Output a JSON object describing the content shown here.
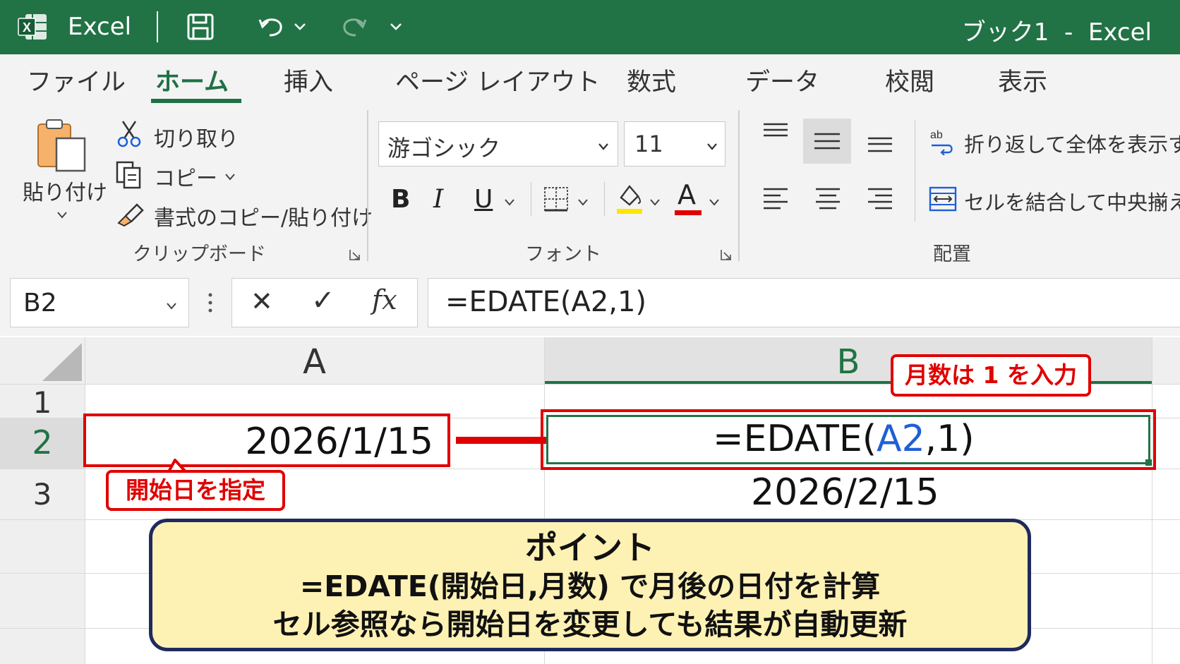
{
  "titlebar": {
    "app_name": "Excel",
    "window_title": "ブック1  -  Excel",
    "bg_color": "#217346"
  },
  "tabs": [
    {
      "label": "ファイル",
      "active": false
    },
    {
      "label": "ホーム",
      "active": true
    },
    {
      "label": "挿入",
      "active": false
    },
    {
      "label": "ページ レイアウト",
      "active": false
    },
    {
      "label": "数式",
      "active": false
    },
    {
      "label": "データ",
      "active": false
    },
    {
      "label": "校閲",
      "active": false
    },
    {
      "label": "表示",
      "active": false
    }
  ],
  "clipboard": {
    "paste_label": "貼り付け",
    "cut_label": "切り取り",
    "copy_label": "コピー",
    "format_painter_label": "書式のコピー/貼り付け",
    "group_label": "クリップボード"
  },
  "font": {
    "font_name": "游ゴシック",
    "font_size": "11",
    "bold_label": "B",
    "italic_label": "I",
    "underline_label": "U",
    "font_color_label": "A",
    "highlight_color": "#ffe600",
    "font_color": "#e00000",
    "group_label": "フォント"
  },
  "alignment": {
    "wrap_text_label": "折り返して全体を表示する",
    "merge_center_label": "セルを結合して中央揃え",
    "group_label": "配置"
  },
  "formula_bar": {
    "name_box": "B2",
    "cancel_symbol": "✕",
    "enter_symbol": "✓",
    "fx_symbol": "fx",
    "formula": "=EDATE(A2,1)"
  },
  "grid": {
    "columns": [
      "A",
      "B"
    ],
    "rows": [
      "1",
      "2",
      "3"
    ],
    "a2": "2026/1/15",
    "b2_parts": {
      "prefix": "=EDATE(",
      "ref": "A2",
      "suffix": ",1)"
    },
    "b3": "2026/2/15",
    "ref_color": "#1f5fd6",
    "select_color": "#217346"
  },
  "annotations": {
    "months_callout": "月数は 1 を入力",
    "start_callout": "開始日を指定",
    "accent_color": "#e00000"
  },
  "point_box": {
    "title": "ポイント",
    "line1": "=EDATE(開始日,月数) で月後の日付を計算",
    "line2": "セル参照なら開始日を変更しても結果が自動更新"
  }
}
